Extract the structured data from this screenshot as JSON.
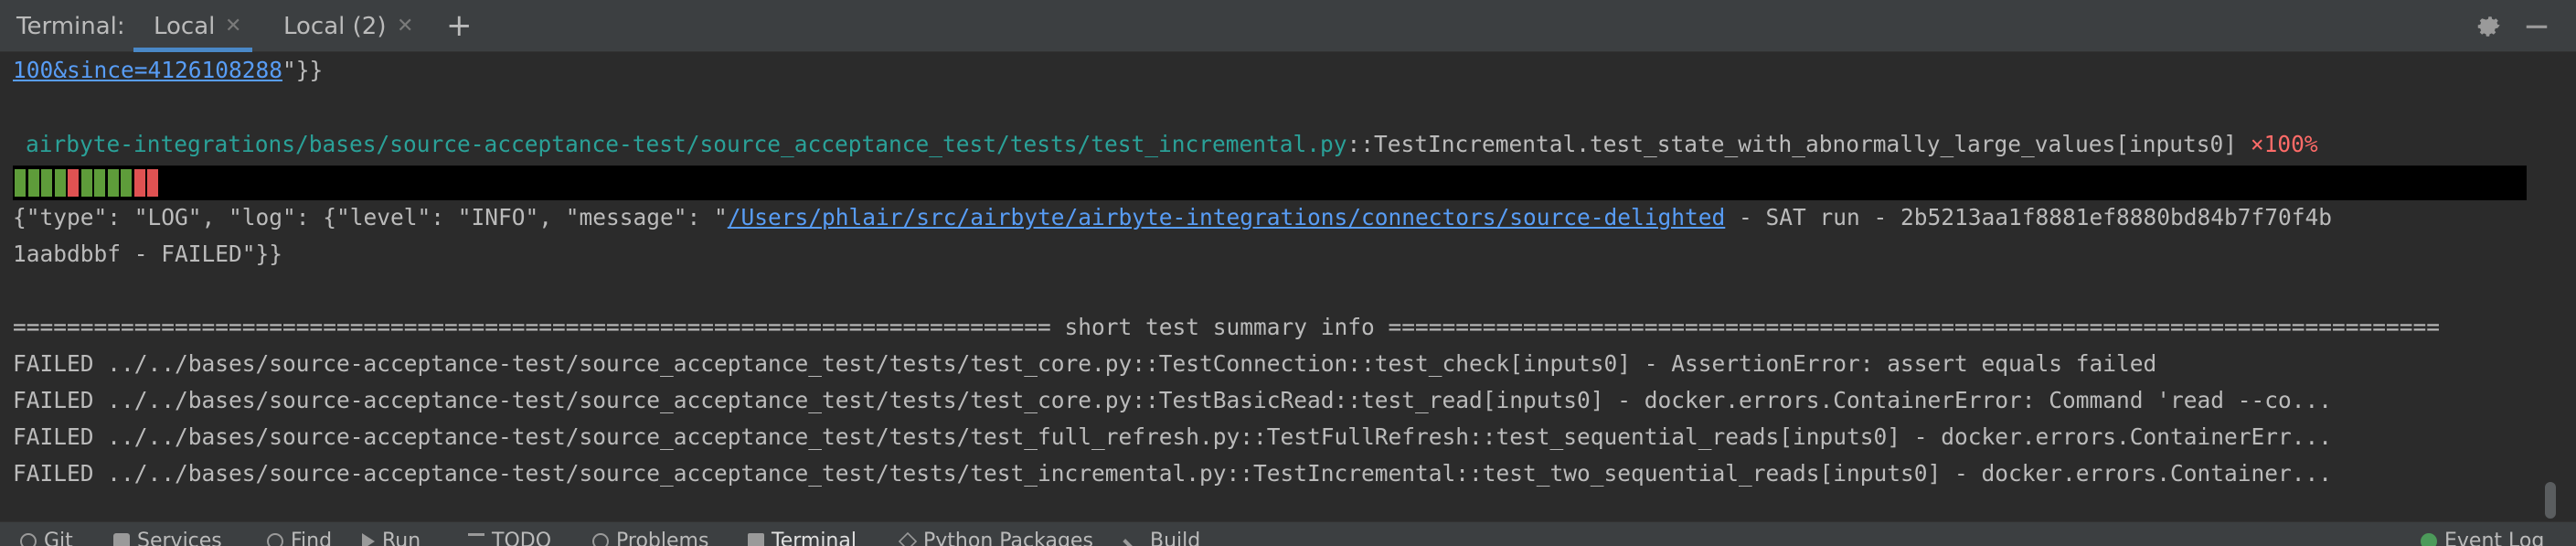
{
  "tabbar": {
    "title": "Terminal:",
    "tabs": [
      {
        "label": "Local",
        "active": true
      },
      {
        "label": "Local (2)",
        "active": false
      }
    ],
    "new_tab_icon": "plus-icon",
    "settings_icon": "gear-icon",
    "hide_icon": "minimize-icon"
  },
  "terminal": {
    "lines": {
      "l1_link": "100&since=4126108288",
      "l1_rest": "\"}}",
      "l3_path": "airbyte-integrations/bases/source-acceptance-test/source_acceptance_test/tests/test_incremental.py",
      "l3_rest": "::TestIncremental.test_state_with_abnormally_large_values[inputs0] ",
      "l3_pct": "×100%",
      "l5_pre": "{\"type\": \"LOG\", \"log\": {\"level\": \"INFO\", \"message\": \"",
      "l5_link": "/Users/phlair/src/airbyte/airbyte-integrations/connectors/source-delighted",
      "l5_post": " - SAT run - 2b5213aa1f8881ef8880bd84b7f70f4b",
      "l6": "1aabdbbf - FAILED\"}}",
      "l8": "============================================================================= short test summary info ==============================================================================",
      "l9": "FAILED ../../bases/source-acceptance-test/source_acceptance_test/tests/test_core.py::TestConnection::test_check[inputs0] - AssertionError: assert equals failed",
      "l10": "FAILED ../../bases/source-acceptance-test/source_acceptance_test/tests/test_core.py::TestBasicRead::test_read[inputs0] - docker.errors.ContainerError: Command 'read --co...",
      "l11": "FAILED ../../bases/source-acceptance-test/source_acceptance_test/tests/test_full_refresh.py::TestFullRefresh::test_sequential_reads[inputs0] - docker.errors.ContainerErr...",
      "l12": "FAILED ../../bases/source-acceptance-test/source_acceptance_test/tests/test_incremental.py::TestIncremental::test_two_sequential_reads[inputs0] - docker.errors.Container..."
    },
    "progress_segments": [
      "pass",
      "pass",
      "pass",
      "pass",
      "fail",
      "pass",
      "pass",
      "pass",
      "pass",
      "fail",
      "fail"
    ],
    "colors": {
      "pass": "#5e9c3a",
      "fail": "#e05252"
    }
  },
  "bottombar": {
    "items": [
      {
        "label": "Git",
        "icon": "git-icon"
      },
      {
        "label": "Services",
        "icon": "services-icon"
      },
      {
        "label": "Find",
        "icon": "search-icon"
      },
      {
        "label": "Run",
        "icon": "run-icon"
      },
      {
        "label": "TODO",
        "icon": "todo-icon"
      },
      {
        "label": "Problems",
        "icon": "problems-icon"
      },
      {
        "label": "Terminal",
        "icon": "terminal-icon"
      },
      {
        "label": "Python Packages",
        "icon": "packages-icon"
      },
      {
        "label": "Build",
        "icon": "build-icon"
      }
    ],
    "event_log": "Event Log"
  }
}
